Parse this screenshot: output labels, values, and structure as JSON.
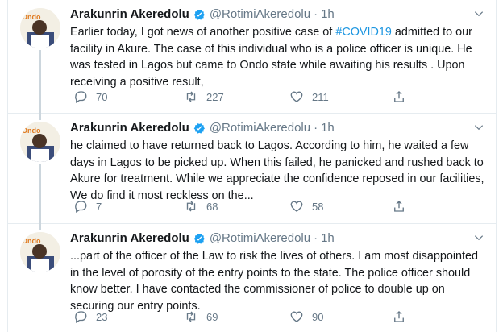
{
  "tweets": [
    {
      "name": "Arakunrin Akeredolu",
      "handle": "@RotimiAkeredolu",
      "dot": "·",
      "time": "1h",
      "text_before": "Earlier today, I got news of another positive case of ",
      "hashtag": "#COVID19",
      "text_after": " admitted to our facility in Akure. The case of this individual who is a police officer is unique. He was tested in Lagos but came to Ondo state while awaiting his results . Upon receiving a positive result,",
      "replies": "70",
      "retweets": "227",
      "likes": "211"
    },
    {
      "name": "Arakunrin Akeredolu",
      "handle": "@RotimiAkeredolu",
      "dot": "·",
      "time": "1h",
      "text": "he claimed to have returned back to Lagos. According to him, he waited a few days in Lagos to be picked up. When this failed, he panicked and rushed back to Akure for treatment. While we appreciate the confidence reposed in our facilities, We do find it most reckless on the...",
      "replies": "7",
      "retweets": "68",
      "likes": "58"
    },
    {
      "name": "Arakunrin Akeredolu",
      "handle": "@RotimiAkeredolu",
      "dot": "·",
      "time": "1h",
      "text": "...part of the officer of the Law to risk the lives of others. I am most disappointed in the level of porosity of the entry points to the state. The police officer should know better. I have contacted the commissioner of police to double up on securing our entry points.",
      "replies": "23",
      "retweets": "69",
      "likes": "90"
    }
  ],
  "colors": {
    "accent": "#1da1f2",
    "hashtag": "#1b95e0",
    "secondary_text": "#657786",
    "border": "#e6ecf0"
  },
  "icons": [
    "verified-badge-icon",
    "chevron-down-icon",
    "reply-icon",
    "retweet-icon",
    "like-icon",
    "share-icon",
    "avatar-logo"
  ]
}
